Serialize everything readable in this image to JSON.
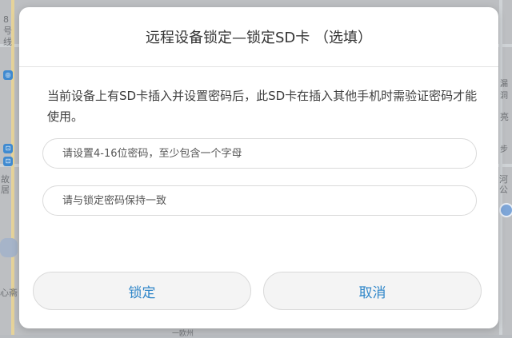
{
  "map": {
    "labels": [
      "8号线",
      "故居",
      "心斋",
      "亮",
      "河公",
      "漏洞",
      "步",
      "一欧州"
    ],
    "badges": [
      "◎",
      "⊡",
      "⊡"
    ]
  },
  "dialog": {
    "title": "远程设备锁定—锁定SD卡 （选填）",
    "description": "当前设备上有SD卡插入并设置密码后，此SD卡在插入其他手机时需验证密码才能使用。",
    "password_field": {
      "placeholder": "请设置4-16位密码，至少包含一个字母",
      "value": ""
    },
    "confirm_field": {
      "placeholder": "请与锁定密码保持一致",
      "value": ""
    },
    "lock_button": "锁定",
    "cancel_button": "取消"
  },
  "colors": {
    "accent": "#2f86c9",
    "dialog_bg": "#ffffff",
    "button_bg": "#f4f4f4"
  }
}
